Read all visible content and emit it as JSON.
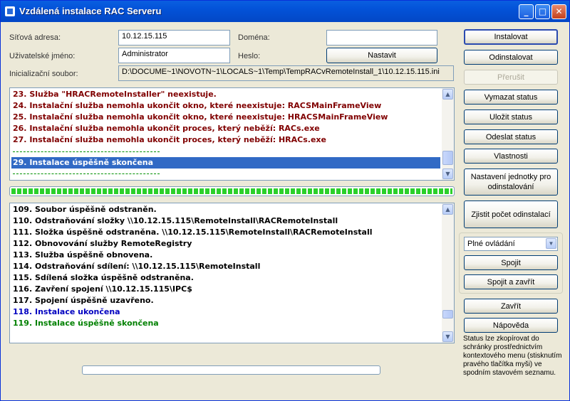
{
  "window": {
    "title": "Vzdálená instalace RAC Serveru",
    "controls": {
      "minimize": "_",
      "maximize": "□",
      "close": "✕"
    }
  },
  "form": {
    "address_label": "Síťová adresa:",
    "address_value": "10.12.15.115",
    "domain_label": "Doména:",
    "domain_value": "",
    "user_label": "Uživatelské jméno:",
    "user_value": "Administrator",
    "password_label": "Heslo:",
    "set_button": "Nastavit",
    "init_label": "Inicializační soubor:",
    "init_value": "D:\\DOCUME~1\\NOVOTN~1\\LOCALS~1\\Temp\\TempRACvRemoteInstall_1\\10.12.15.115.ini"
  },
  "status_log": [
    {
      "text": "23. Služba \"HRACRemoteInstaller\" neexistuje.",
      "color": "red"
    },
    {
      "text": "24. Instalační služba nemohla ukončit okno, které neexistuje: RACSMainFrameView",
      "color": "red"
    },
    {
      "text": "25. Instalační služba nemohla ukončit okno, které neexistuje: HRACSMainFrameView",
      "color": "red"
    },
    {
      "text": "26. Instalační služba nemohla ukončit proces, který neběží: RACs.exe",
      "color": "red"
    },
    {
      "text": "27. Instalační služba nemohla ukončit proces, který neběží: HRACs.exe",
      "color": "red"
    },
    {
      "text": "29. Instalace úspěšně skončena",
      "color": "sel"
    }
  ],
  "top_progress": 1.0,
  "detail_log": [
    {
      "text": "109. Soubor úspěšně odstraněn.",
      "color": "black"
    },
    {
      "text": "110. Odstraňování složky \\\\10.12.15.115\\RemoteInstall\\RACRemoteInstall",
      "color": "black"
    },
    {
      "text": "111. Složka úspěšně odstraněna. \\\\10.12.15.115\\RemoteInstall\\RACRemoteInstall",
      "color": "black"
    },
    {
      "text": "112. Obnovování služby RemoteRegistry",
      "color": "black"
    },
    {
      "text": "113. Služba úspěšně obnovena.",
      "color": "black"
    },
    {
      "text": "114. Odstraňování sdílení: \\\\10.12.15.115\\RemoteInstall",
      "color": "black"
    },
    {
      "text": "115. Sdílená složka úspěšně odstraněna.",
      "color": "black"
    },
    {
      "text": "116. Zavření spojení \\\\10.12.15.115\\IPC$",
      "color": "black"
    },
    {
      "text": "117. Spojení úspěšně uzavřeno.",
      "color": "black"
    },
    {
      "text": "118. Instalace ukončena",
      "color": "blue"
    },
    {
      "text": "119. Instalace úspěšně skončena",
      "color": "green"
    }
  ],
  "bottom_progress": 0.0,
  "buttons": {
    "install": "Instalovat",
    "uninstall": "Odinstalovat",
    "interrupt": "Přerušit",
    "clear_status": "Vymazat status",
    "save_status": "Uložit status",
    "send_status": "Odeslat status",
    "properties": "Vlastnosti",
    "uninstall_units_settings": "Nastavení jednotky pro odinstalování",
    "count_uninstalls": "Zjistit počet odinstalací",
    "connect": "Spojit",
    "connect_close": "Spojit a zavřít",
    "close": "Zavřít",
    "help": "Nápověda"
  },
  "control_mode": {
    "selected": "Plné ovládání"
  },
  "note": "Status lze zkopírovat do schránky prostřednictvím kontextového menu (stisknutím pravého tlačítka myši) ve spodním stavovém seznamu."
}
